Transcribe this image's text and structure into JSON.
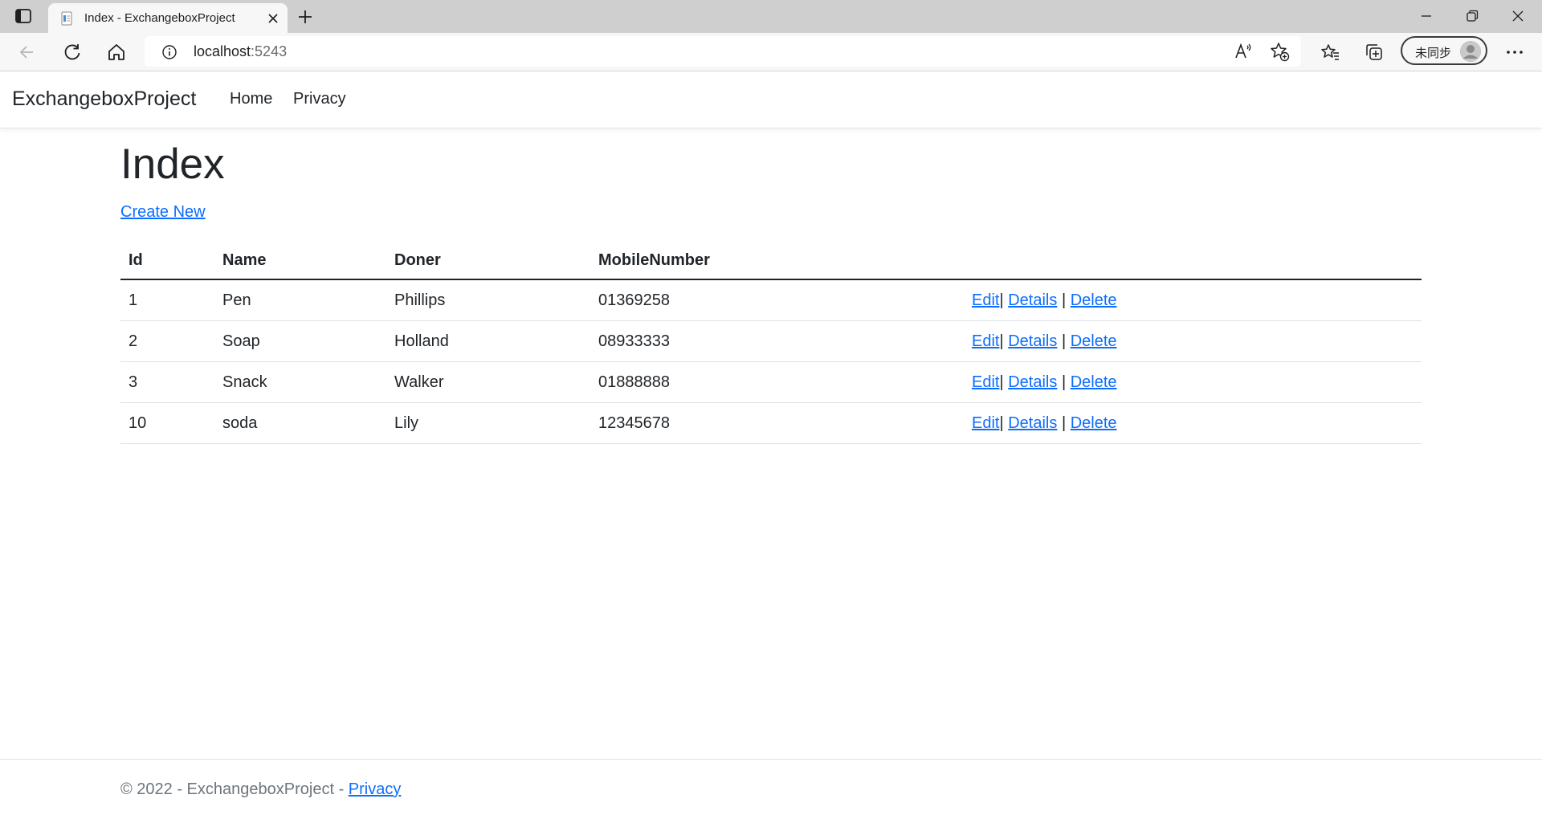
{
  "browser": {
    "tab_title": "Index - ExchangeboxProject",
    "url_host": "localhost",
    "url_port": ":5243",
    "profile_label": "未同步"
  },
  "nav": {
    "brand": "ExchangeboxProject",
    "links": [
      "Home",
      "Privacy"
    ]
  },
  "page": {
    "title": "Index",
    "create_link": "Create New"
  },
  "table": {
    "headers": [
      "Id",
      "Name",
      "Doner",
      "MobileNumber",
      ""
    ],
    "rows": [
      {
        "id": "1",
        "name": "Pen",
        "doner": "Phillips",
        "mobile": "01369258"
      },
      {
        "id": "2",
        "name": "Soap",
        "doner": "Holland",
        "mobile": "08933333"
      },
      {
        "id": "3",
        "name": "Snack",
        "doner": "Walker",
        "mobile": "01888888"
      },
      {
        "id": "10",
        "name": "soda",
        "doner": "Lily",
        "mobile": "12345678"
      }
    ],
    "actions": {
      "edit": "Edit",
      "details": "Details",
      "delete": "Delete",
      "separator": "|"
    }
  },
  "footer": {
    "text": "© 2022 - ExchangeboxProject - ",
    "link": "Privacy"
  },
  "colors": {
    "link": "#0d6efd",
    "text": "#212529",
    "muted": "#6c757d"
  },
  "icons": [
    "sidebar-toggle-icon",
    "page-favicon-icon",
    "close-icon",
    "plus-icon",
    "minimize-icon",
    "restore-icon",
    "close-window-icon",
    "back-icon",
    "refresh-icon",
    "home-icon",
    "info-icon",
    "read-aloud-icon",
    "add-favorite-icon",
    "favorites-icon",
    "collections-icon",
    "avatar-icon",
    "more-icon"
  ]
}
